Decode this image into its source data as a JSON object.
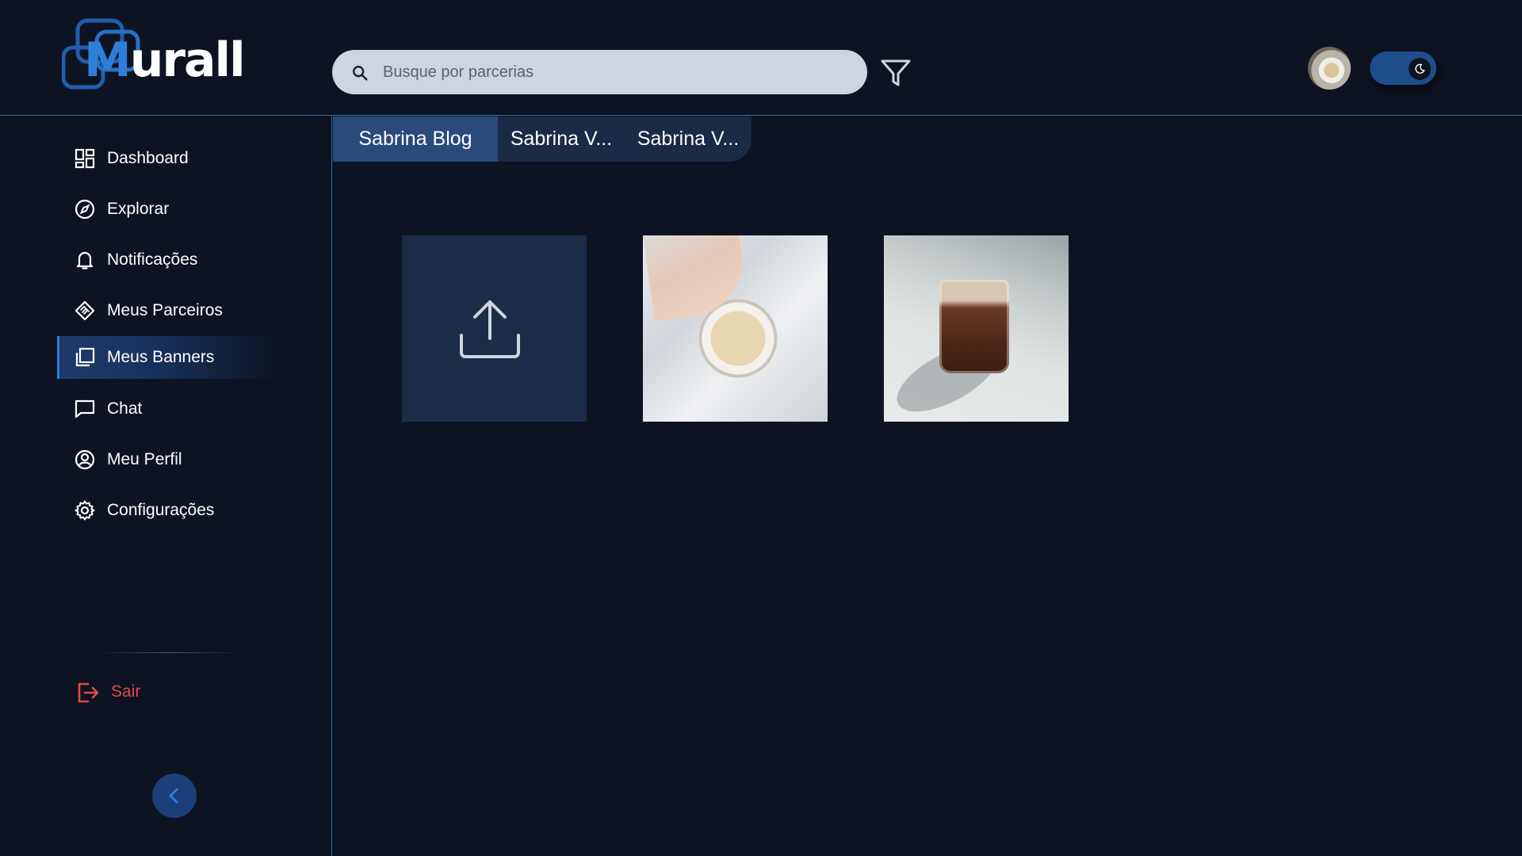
{
  "app": {
    "logo_text_m": "M",
    "logo_text_rest": "urall"
  },
  "header": {
    "search_placeholder": "Busque por parcerias",
    "search_value": "",
    "theme": "dark"
  },
  "sidebar": {
    "items": [
      {
        "label": "Dashboard",
        "icon": "dashboard-icon",
        "active": false
      },
      {
        "label": "Explorar",
        "icon": "compass-icon",
        "active": false
      },
      {
        "label": "Notificações",
        "icon": "bell-icon",
        "active": false
      },
      {
        "label": "Meus Parceiros",
        "icon": "handshake-icon",
        "active": false
      },
      {
        "label": "Meus Banners",
        "icon": "banners-icon",
        "active": true
      },
      {
        "label": "Chat",
        "icon": "chat-icon",
        "active": false
      },
      {
        "label": "Meu Perfil",
        "icon": "profile-icon",
        "active": false
      },
      {
        "label": "Configurações",
        "icon": "gear-icon",
        "active": false
      }
    ],
    "logout_label": "Sair"
  },
  "main": {
    "tabs": [
      {
        "label": "Sabrina Blog",
        "active": true
      },
      {
        "label": "Sabrina V...",
        "active": false
      },
      {
        "label": "Sabrina V...",
        "active": false
      }
    ],
    "tiles": [
      {
        "type": "upload",
        "icon": "upload-icon"
      },
      {
        "type": "image",
        "subject": "coffee-mug-photo"
      },
      {
        "type": "image",
        "subject": "coffee-glass-photo"
      }
    ]
  },
  "colors": {
    "background": "#0d1321",
    "accent": "#2f7fd8",
    "border": "#2b6cb0",
    "active_tab": "#2a4a7b",
    "tab": "#1b2a47",
    "upload_tile": "#1c2b48",
    "logout": "#e24b4b"
  }
}
